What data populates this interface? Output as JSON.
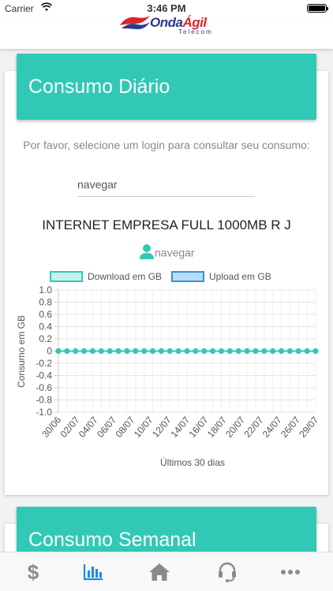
{
  "status_bar": {
    "carrier": "Carrier",
    "time": "3:46 PM"
  },
  "header": {
    "logo_primary": "Onda",
    "logo_accent": "Ágil",
    "logo_sub": "Telecom"
  },
  "daily_card": {
    "title": "Consumo Diário",
    "instruction": "Por favor, selecione um login para consultar seu consumo:",
    "login_value": "navegar",
    "plan_name": "INTERNET EMPRESA FULL 1000MB R J",
    "user_login": "navegar"
  },
  "weekly_card": {
    "title": "Consumo Semanal"
  },
  "colors": {
    "accent": "#31c9b5",
    "download": "#31c9b5",
    "upload": "#3b8fd9",
    "tab_active": "#1e88e5",
    "tab_inactive": "#8a8a8a"
  },
  "tabs": [
    {
      "icon": "dollar-icon",
      "active": false
    },
    {
      "icon": "bar-chart-icon",
      "active": true
    },
    {
      "icon": "home-icon",
      "active": false
    },
    {
      "icon": "headset-icon",
      "active": false
    },
    {
      "icon": "more-icon",
      "active": false
    }
  ],
  "chart_data": {
    "type": "line",
    "legend": [
      "Download em GB",
      "Upload em GB"
    ],
    "series": [
      {
        "name": "Download em GB",
        "values": [
          0,
          0,
          0,
          0,
          0,
          0,
          0,
          0,
          0,
          0,
          0,
          0,
          0,
          0,
          0,
          0,
          0,
          0,
          0,
          0,
          0,
          0,
          0,
          0,
          0,
          0,
          0,
          0,
          0,
          0,
          0
        ]
      },
      {
        "name": "Upload em GB",
        "values": [
          0,
          0,
          0,
          0,
          0,
          0,
          0,
          0,
          0,
          0,
          0,
          0,
          0,
          0,
          0,
          0,
          0,
          0,
          0,
          0,
          0,
          0,
          0,
          0,
          0,
          0,
          0,
          0,
          0,
          0,
          0
        ]
      }
    ],
    "x_tick_labels": [
      "30/06",
      "02/07",
      "04/07",
      "06/07",
      "08/07",
      "10/07",
      "12/07",
      "14/07",
      "16/07",
      "18/07",
      "20/07",
      "22/07",
      "24/07",
      "26/07",
      "29/07"
    ],
    "y_ticks": [
      "1.0",
      "0.8",
      "0.6",
      "0.4",
      "0.2",
      "0",
      "-0.2",
      "-0.4",
      "-0.6",
      "-0.8",
      "-1.0"
    ],
    "ylim": [
      -1.0,
      1.0
    ],
    "xlabel": "Últimos 30 dias",
    "ylabel": "Consumo em GB",
    "grid": true,
    "legend_position": "top"
  }
}
